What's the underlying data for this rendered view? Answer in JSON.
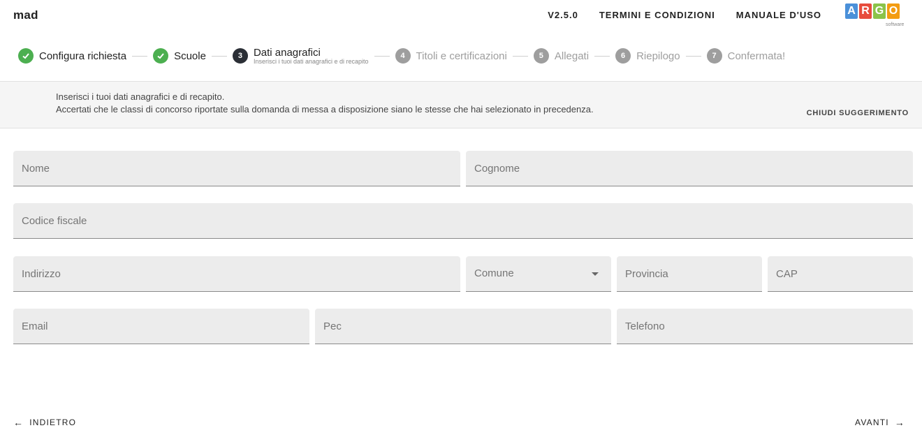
{
  "app": {
    "name": "mad",
    "version": "V2.5.0",
    "terms": "TERMINI E CONDIZIONI",
    "manual": "MANUALE D'USO",
    "brand_letters": [
      "A",
      "R",
      "G",
      "O"
    ],
    "brand_colors": [
      "#4a90d9",
      "#e74c3c",
      "#8bc34a",
      "#f39c12"
    ],
    "brand_sub": "software"
  },
  "stepper": {
    "steps": [
      {
        "number": "1",
        "label": "Configura richiesta",
        "state": "done"
      },
      {
        "number": "2",
        "label": "Scuole",
        "state": "done"
      },
      {
        "number": "3",
        "label": "Dati anagrafici",
        "sublabel": "Inserisci i tuoi dati anagrafici e di recapito",
        "state": "active"
      },
      {
        "number": "4",
        "label": "Titoli e certificazioni",
        "state": "pending"
      },
      {
        "number": "5",
        "label": "Allegati",
        "state": "pending"
      },
      {
        "number": "6",
        "label": "Riepilogo",
        "state": "pending"
      },
      {
        "number": "7",
        "label": "Confermata!",
        "state": "pending"
      }
    ],
    "done_icon": "check-icon"
  },
  "hint": {
    "line1": "Inserisci i tuoi dati anagrafici e di recapito.",
    "line2": "Accertati che le classi di concorso riportate sulla domanda di messa a disposizione siano le stesse che hai selezionato in precedenza.",
    "close_label": "CHIUDI SUGGERIMENTO"
  },
  "form": {
    "nome": {
      "placeholder": "Nome",
      "value": ""
    },
    "cognome": {
      "placeholder": "Cognome",
      "value": ""
    },
    "codice_fiscale": {
      "placeholder": "Codice fiscale",
      "value": ""
    },
    "indirizzo": {
      "placeholder": "Indirizzo",
      "value": ""
    },
    "comune": {
      "placeholder": "Comune",
      "value": ""
    },
    "provincia": {
      "placeholder": "Provincia",
      "value": ""
    },
    "cap": {
      "placeholder": "CAP",
      "value": ""
    },
    "email": {
      "placeholder": "Email",
      "value": ""
    },
    "pec": {
      "placeholder": "Pec",
      "value": ""
    },
    "telefono": {
      "placeholder": "Telefono",
      "value": ""
    }
  },
  "footer": {
    "prev_label": "INDIETRO",
    "next_label": "AVANTI",
    "prev_icon": "arrow-left-icon",
    "next_icon": "arrow-right-icon"
  }
}
